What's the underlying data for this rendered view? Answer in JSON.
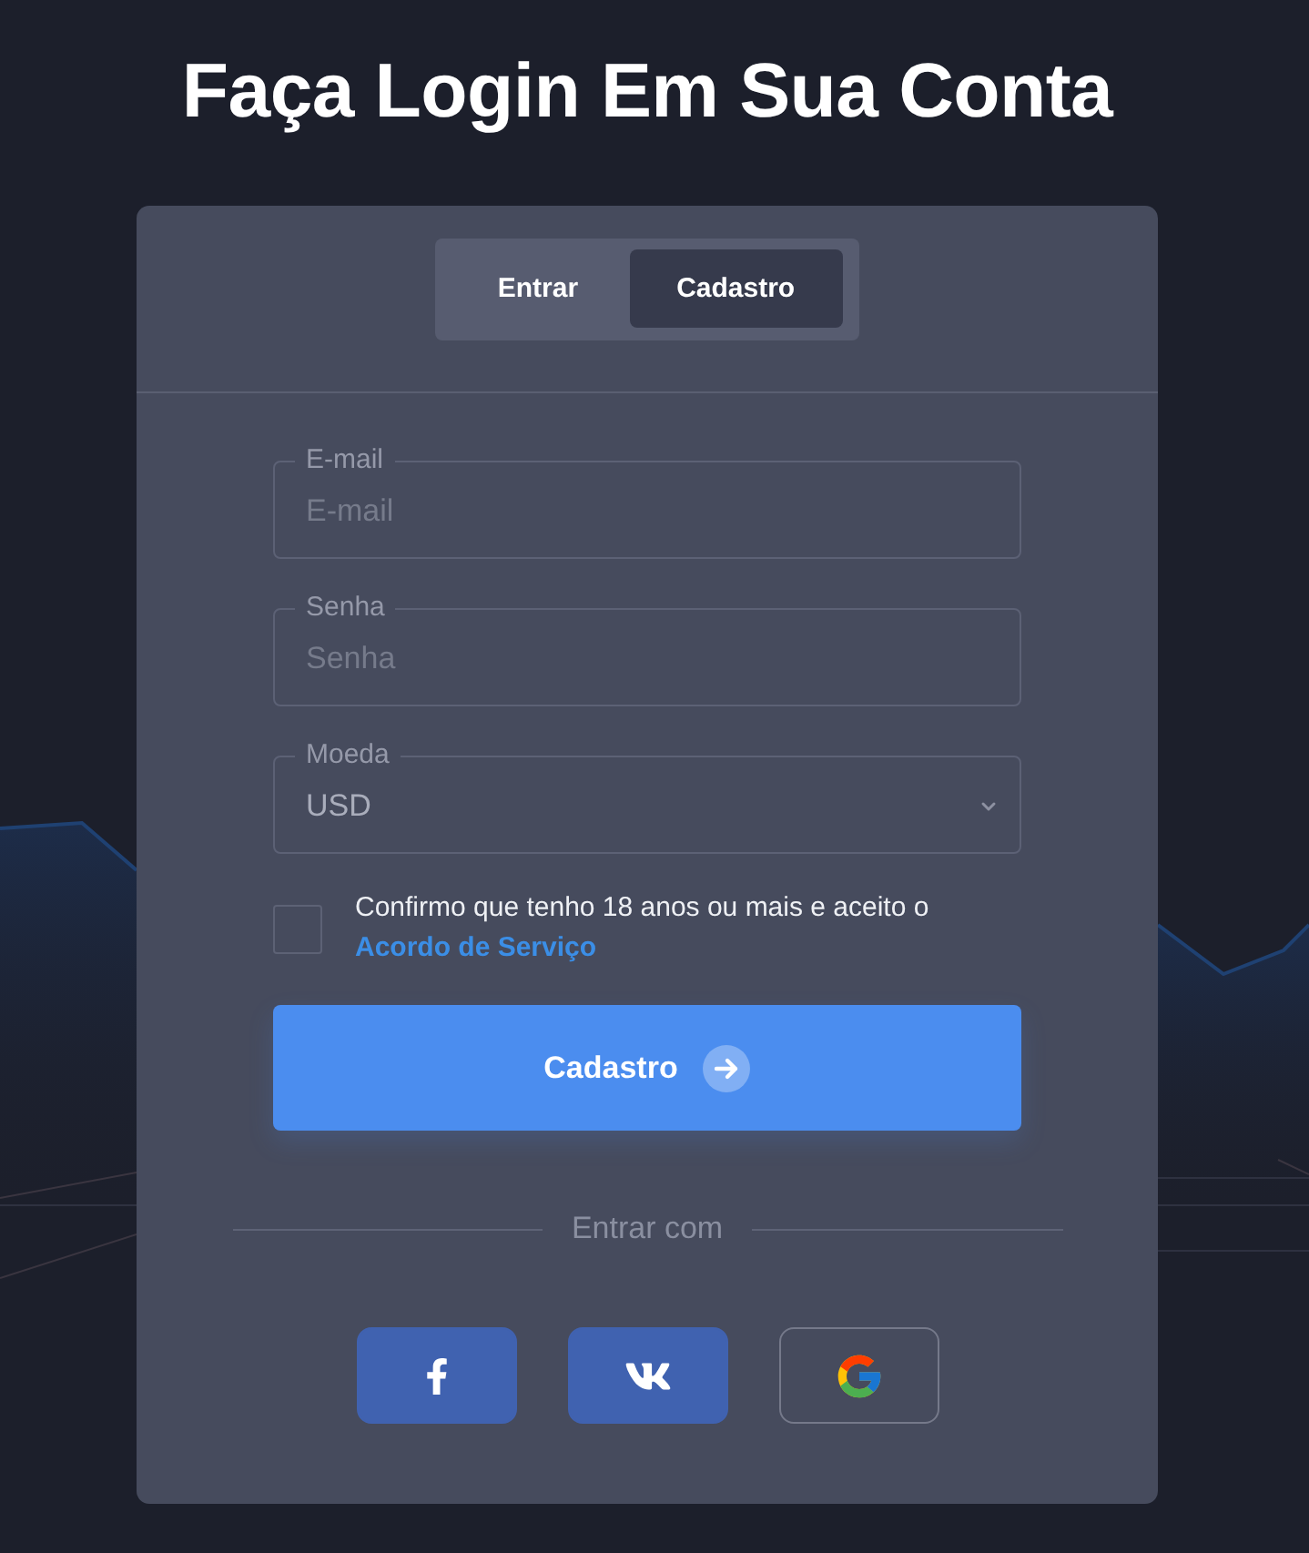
{
  "heading": "Faça Login Em Sua Conta",
  "tabs": [
    {
      "label": "Entrar",
      "selected": false
    },
    {
      "label": "Cadastro",
      "selected": true
    }
  ],
  "fields": [
    {
      "kind": "text",
      "label": "E-mail",
      "placeholder": "E-mail"
    },
    {
      "kind": "password",
      "label": "Senha",
      "placeholder": "Senha"
    },
    {
      "kind": "select",
      "label": "Moeda",
      "value": "USD"
    }
  ],
  "agreement": {
    "checked": false,
    "text": "Confirmo que tenho 18 anos ou mais e aceito o",
    "link": "Acordo de Serviço"
  },
  "submit": {
    "label": "Cadastro"
  },
  "social": {
    "caption": "Entrar com",
    "buttons": [
      {
        "kind": "facebook"
      },
      {
        "kind": "vk"
      },
      {
        "kind": "google"
      }
    ]
  }
}
